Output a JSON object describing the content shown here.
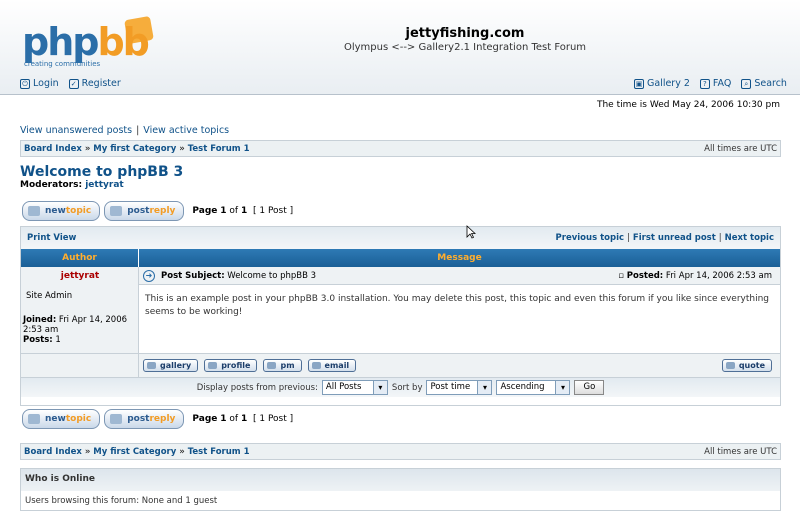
{
  "header": {
    "logo_text_a": "php",
    "logo_text_b": "bb",
    "logo_tagline": "creating communities",
    "site_name": "jettyfishing.com",
    "site_desc": "Olympus <--> Gallery2.1 Integration Test Forum",
    "nav_left": [
      {
        "label": "Login",
        "icon": "login-icon"
      },
      {
        "label": "Register",
        "icon": "register-icon"
      }
    ],
    "nav_right": [
      {
        "label": "Gallery 2",
        "icon": "gallery-icon"
      },
      {
        "label": "FAQ",
        "icon": "faq-icon"
      },
      {
        "label": "Search",
        "icon": "search-icon"
      }
    ]
  },
  "time_text": "The time is Wed May 24, 2006 10:30 pm",
  "quick_links": [
    "View unanswered posts",
    "View active topics"
  ],
  "breadcrumb": {
    "items": [
      "Board Index",
      "My first Category",
      "Test Forum 1"
    ],
    "sep": "»",
    "timezone": "All times are UTC"
  },
  "forum": {
    "title": "Welcome to phpBB 3",
    "moderators_label": "Moderators:",
    "moderator": "jettyrat"
  },
  "buttons": {
    "newtopic_a": "new",
    "newtopic_b": "topic",
    "postreply_a": "post",
    "postreply_b": "reply",
    "page_label": "Page",
    "page_current": "1",
    "page_of": "of",
    "page_total": "1",
    "post_count": "[ 1 Post ]"
  },
  "topic_table": {
    "print_view": "Print View",
    "prev_topic": "Previous topic",
    "first_unread": "First unread post",
    "next_topic": "Next topic",
    "col_author": "Author",
    "col_message": "Message"
  },
  "post": {
    "author": "jettyrat",
    "rank": "Site Admin",
    "joined_label": "Joined:",
    "joined_value": "Fri Apr 14, 2006 2:53 am",
    "posts_label": "Posts:",
    "posts_value": "1",
    "subject_label": "Post Subject:",
    "subject_value": "Welcome to phpBB 3",
    "posted_label": "Posted:",
    "posted_value": "Fri Apr 14, 2006 2:53 am",
    "body": "This is an example post in your phpBB 3.0 installation. You may delete this post, this topic and even this forum if you like since everything seems to be working!",
    "actions": [
      "gallery",
      "profile",
      "pm",
      "email"
    ],
    "quote_label": "quote"
  },
  "filter": {
    "display_label": "Display posts from previous:",
    "display_value": "All Posts",
    "sort_label": "Sort by",
    "sort_value": "Post time",
    "order_value": "Ascending",
    "go_label": "Go"
  },
  "who_online": {
    "title": "Who is Online",
    "text": "Users browsing this forum: None and 1 guest"
  }
}
